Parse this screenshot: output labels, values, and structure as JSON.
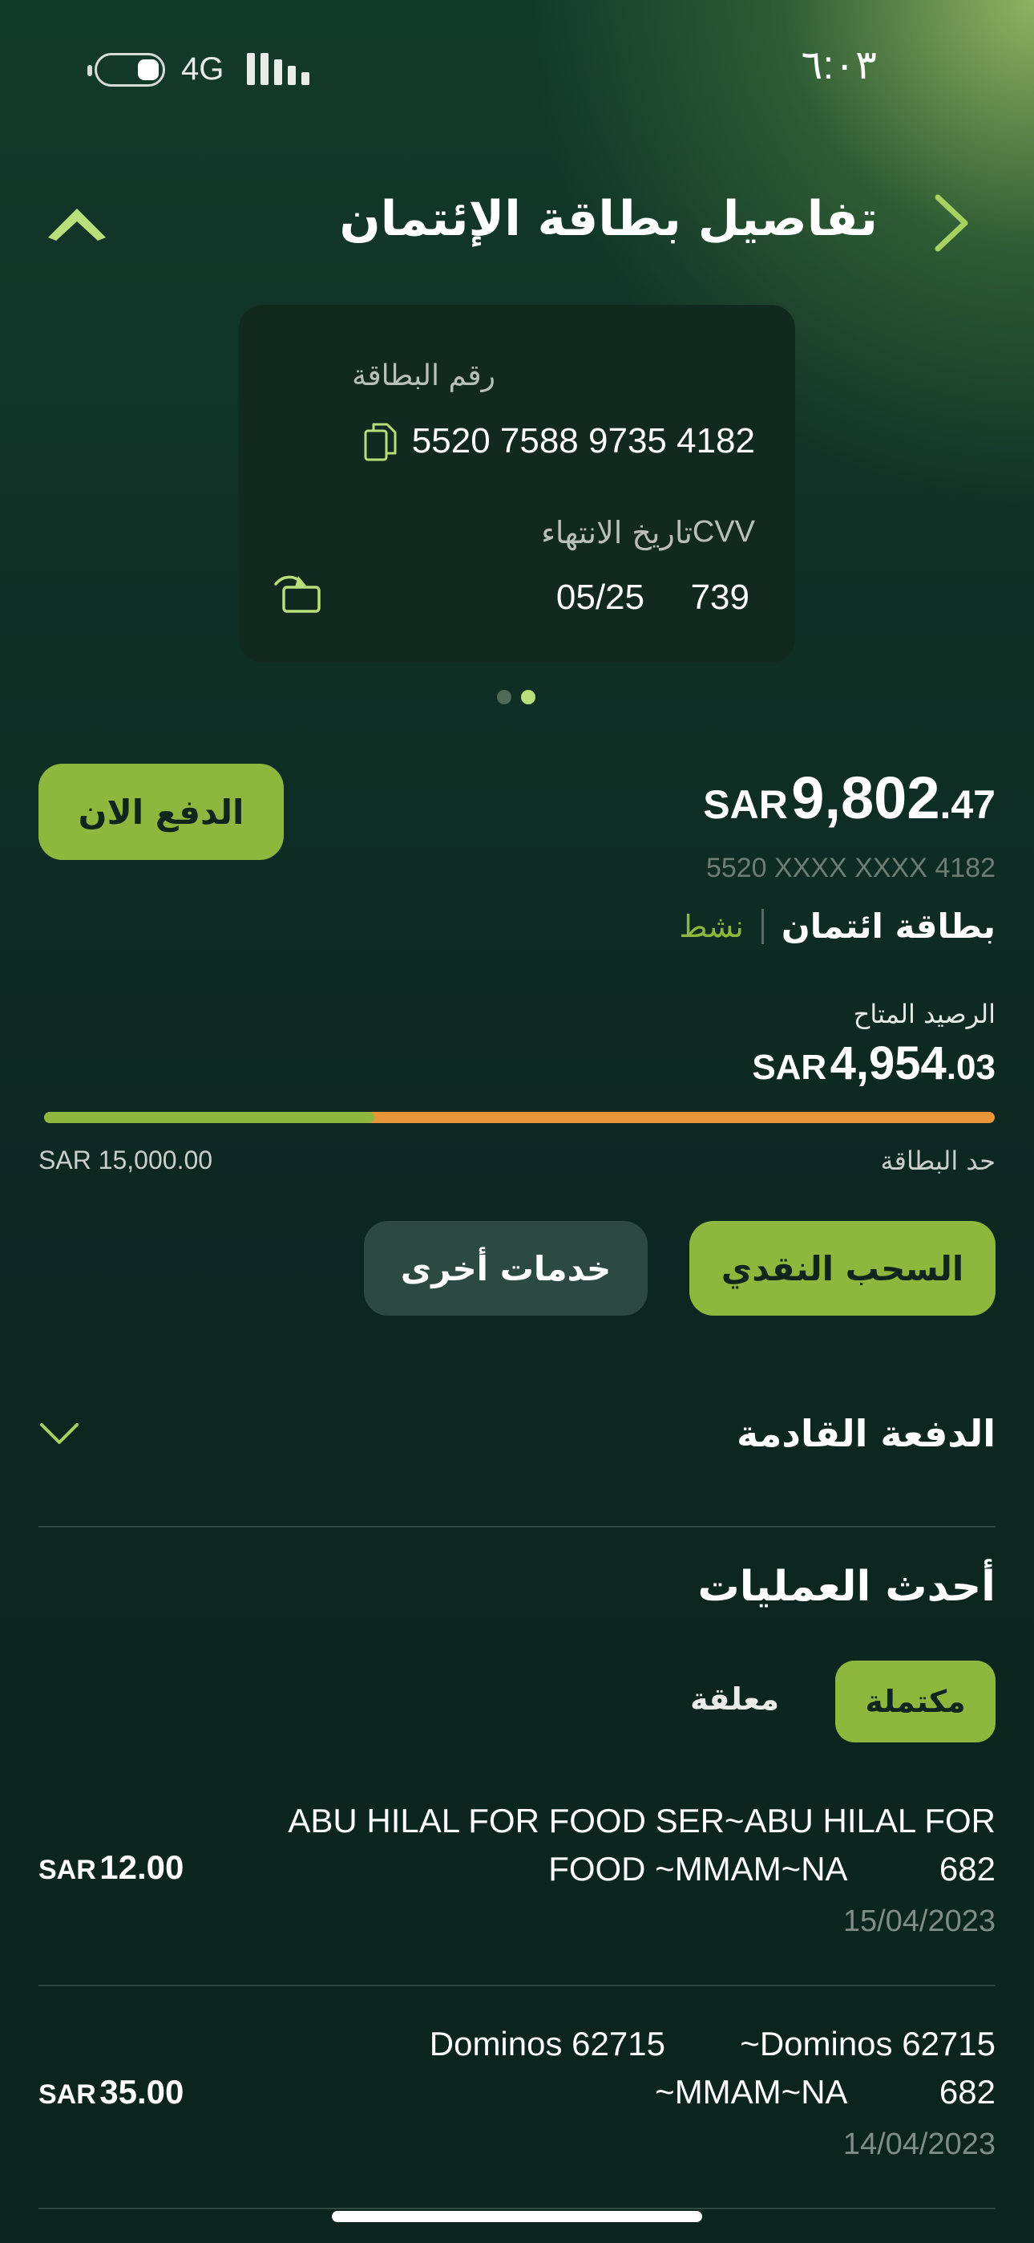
{
  "status_bar": {
    "time": "٦:٠٣",
    "network": "4G"
  },
  "header": {
    "title": "تفاصيل بطاقة الإئتمان",
    "back_icon": "chevron-right-icon",
    "collapse_icon": "chevron-up-icon"
  },
  "card": {
    "number_label": "رقم البطاقة",
    "number": "5520 7588 9735 4182",
    "cvv_label": "CVV",
    "expiry_label": "تاريخ الانتهاء",
    "cvv": "739",
    "expiry": "05/25",
    "copy_icon": "copy-icon",
    "flip_icon": "flip-card-icon"
  },
  "pager": {
    "count": 2,
    "active": 1
  },
  "summary": {
    "pay_button": "الدفع الان",
    "balance_currency": "SAR",
    "balance_whole": "9,802",
    "balance_decimal": ".47",
    "masked_number": "5520 XXXX XXXX 4182",
    "card_type": "بطاقة ائتمان",
    "status": "نشط"
  },
  "available": {
    "label": "الرصيد المتاح",
    "currency": "SAR",
    "whole": "4,954",
    "decimal": ".03",
    "limit_label": "حد البطاقة",
    "limit_value": "SAR 15,000.00",
    "used_fraction": 0.347
  },
  "actions": {
    "cash_withdrawal": "السحب النقدي",
    "other_services": "خدمات أخرى"
  },
  "next_payment": {
    "title": "الدفعة القادمة",
    "icon": "chevron-down-icon"
  },
  "transactions": {
    "title": "أحدث العمليات",
    "tab_completed": "مكتملة",
    "tab_pending": "معلقة",
    "items": [
      {
        "description": "ABU HILAL FOR FOOD SER~ABU HILAL FOR\nFOOD ~MMAM~NA          682",
        "date": "15/04/2023",
        "currency": "SAR",
        "amount": "12.00"
      },
      {
        "description": "Dominos 62715        ~Dominos 62715\n~MMAM~NA          682",
        "date": "14/04/2023",
        "currency": "SAR",
        "amount": "35.00"
      }
    ]
  },
  "colors": {
    "accent": "#8db83d",
    "warning": "#e8953a",
    "card_bg": "#11291f"
  }
}
